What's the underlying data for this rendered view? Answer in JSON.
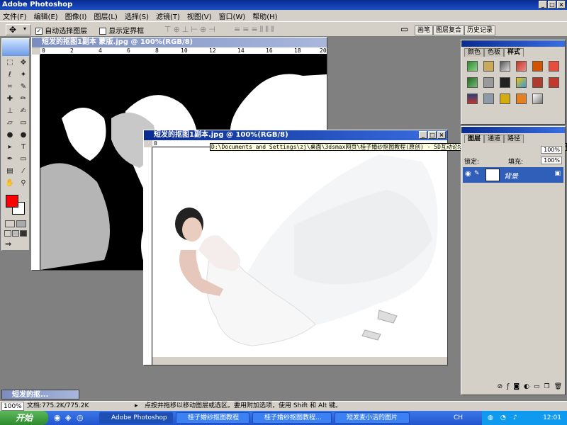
{
  "app": {
    "title": "Adobe Photoshop"
  },
  "menu": [
    "文件(F)",
    "编辑(E)",
    "图像(I)",
    "图层(L)",
    "选择(S)",
    "滤镜(T)",
    "视图(V)",
    "窗口(W)",
    "帮助(H)"
  ],
  "options": {
    "auto_select_layer": "自动选择图层",
    "show_bounding_box": "显示定界框",
    "auto_select_checked": true
  },
  "palette_tabs_top": [
    "画笔",
    "图层复合",
    "历史记录"
  ],
  "doc1": {
    "title": "短发的抠图1副本 蒙版.jpg @ 100%(RGB/8)",
    "ruler": [
      "0",
      "2",
      "4",
      "6",
      "8",
      "10",
      "12",
      "14",
      "16",
      "18",
      "20"
    ]
  },
  "doc2": {
    "title": "短发的抠图1副本.jpg @ 100%(RGB/8)",
    "ruler": [
      "0",
      "2",
      "4",
      "6",
      "8",
      "10",
      "12",
      "14",
      "16",
      "18",
      "20"
    ]
  },
  "tooltip": "D:\\Documents and Settings\\zj\\桌面\\3dsmax网页\\桂子婚纱抠图教程(原创) - 5D互动论坛.files\\短发的抠图1副本.jpg @ 100%(RGB/8)",
  "color_palette": {
    "tabs": [
      "颜色",
      "色板",
      "样式"
    ]
  },
  "layers_palette": {
    "tabs": [
      "图层",
      "通道",
      "路径"
    ],
    "lock_label": "锁定:",
    "fill_label": "填充:",
    "fill_value": "100%",
    "opacity_value": "100%",
    "layer_name": "背景"
  },
  "minimized_doc": {
    "title": "短发的抠..."
  },
  "statusbar": {
    "zoom": "100%",
    "doc_size": "文档:775.2K/775.2K",
    "hint": "点按并拖移以移动图层或选区。要用附加选项，使用 Shift 和 Alt 键。"
  },
  "taskbar": {
    "start": "开始",
    "tasks": [
      "Adobe Photoshop",
      "桂子婚纱抠图教程",
      "桂子婚纱抠图教程...",
      "短发麦小洁的图片"
    ],
    "lang": "CH",
    "time": "12:01"
  },
  "colors": {
    "foreground": "#ff0000",
    "background": "#ffffff",
    "title_active": "#0a2b8f"
  }
}
